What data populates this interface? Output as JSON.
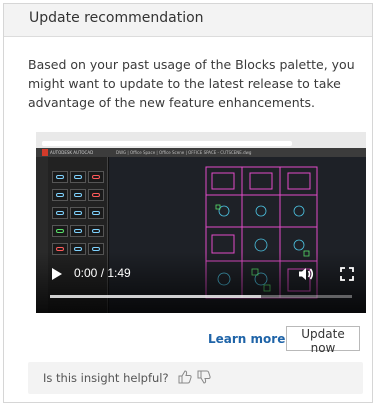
{
  "header": {
    "title": "Update recommendation"
  },
  "message": "Based on your past usage of the Blocks palette, you might want to update to the latest release to take advantage of the new feature enhancements.",
  "video": {
    "time_display": "0:00 / 1:49",
    "progress_fraction": 0.7,
    "icons": [
      "play-icon",
      "volume-icon",
      "fullscreen-icon"
    ],
    "thumbnail": {
      "app_name": "AUTODESK AUTOCAD",
      "tabs": "DWG | Office Space | Office Scene | OFFICE SPACE - CUTSCENE.dwg",
      "accent_color": "#d23b2b",
      "plan_color": "#e24cc8"
    }
  },
  "actions": {
    "learn_more_label": "Learn more",
    "update_now_label": "Update now",
    "link_color": "#1f64a8"
  },
  "feedback": {
    "question": "Is this insight helpful?",
    "icons": [
      "thumbs-up-icon",
      "thumbs-down-icon"
    ]
  }
}
